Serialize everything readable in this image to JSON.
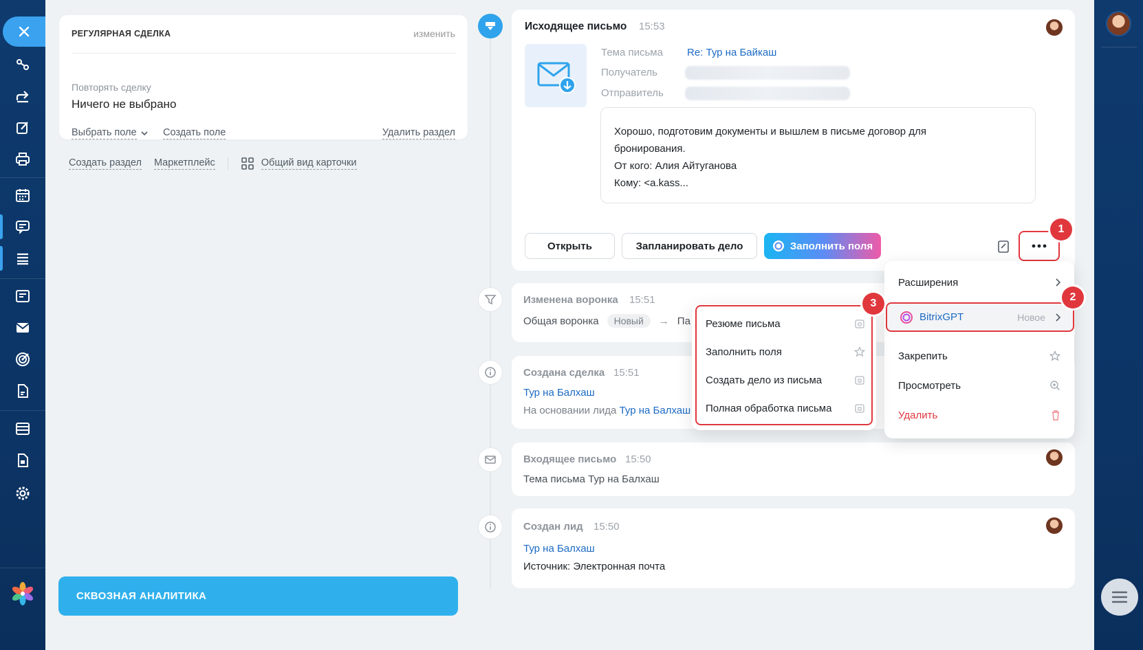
{
  "regular_deal": {
    "title": "РЕГУЛЯРНАЯ СДЕЛКА",
    "edit": "изменить",
    "repeat_label": "Повторять сделку",
    "repeat_value": "Ничего не выбрано",
    "select_field": "Выбрать поле",
    "create_field": "Создать поле",
    "delete_section": "Удалить раздел"
  },
  "left_links": {
    "create_section": "Создать раздел",
    "marketplace": "Маркетплейс",
    "card_view": "Общий вид карточки"
  },
  "analytics_button": "СКВОЗНАЯ АНАЛИТИКА",
  "email_card": {
    "title": "Исходящее письмо",
    "time": "15:53",
    "subject_label": "Тема письма",
    "subject_value": "Re: Тур на Байкаш",
    "recipient_label": "Получатель",
    "sender_label": "Отправитель",
    "body_line1": "Хорошо, подготовим документы и вышлем в письме договор для",
    "body_line2": "бронирования.",
    "body_line3": "От кого: Алия Айтуганова",
    "body_line4": "Кому: <a.kass...",
    "open_button": "Открыть",
    "schedule_button": "Запланировать дело",
    "fill_button": "Заполнить поля"
  },
  "funnel_card": {
    "title": "Изменена воронка",
    "time": "15:51",
    "funnel": "Общая воронка",
    "stage": "Новый",
    "arrow": "→",
    "next": "Па"
  },
  "deal_card": {
    "title": "Создана сделка",
    "time": "15:51",
    "deal_link": "Тур на Балхаш",
    "basis_prefix": "На основании лида",
    "basis_link": "Тур на Балхаш"
  },
  "incoming_card": {
    "title": "Входящее письмо",
    "time": "15:50",
    "subject_label": "Тема письма",
    "subject_value": "Тур на Балхаш"
  },
  "lead_card": {
    "title": "Создан лид",
    "time": "15:50",
    "lead_link": "Тур на Балхаш",
    "source": "Источник: Электронная почта"
  },
  "menu_main": {
    "extensions": "Расширения",
    "bitrixgpt": "BitrixGPT",
    "new_badge": "Новое",
    "pin": "Закрепить",
    "view": "Просмотреть",
    "delete": "Удалить"
  },
  "menu_gpt": {
    "summary": "Резюме письма",
    "fill_fields": "Заполнить поля",
    "create_task": "Создать дело из письма",
    "full_processing": "Полная обработка письма"
  },
  "badges": {
    "one": "1",
    "two": "2",
    "three": "3"
  },
  "colors": {
    "accent": "#2fb0ec",
    "highlight": "#e0373d",
    "link": "#1b6ac4",
    "sidebar": "#0c3566"
  }
}
